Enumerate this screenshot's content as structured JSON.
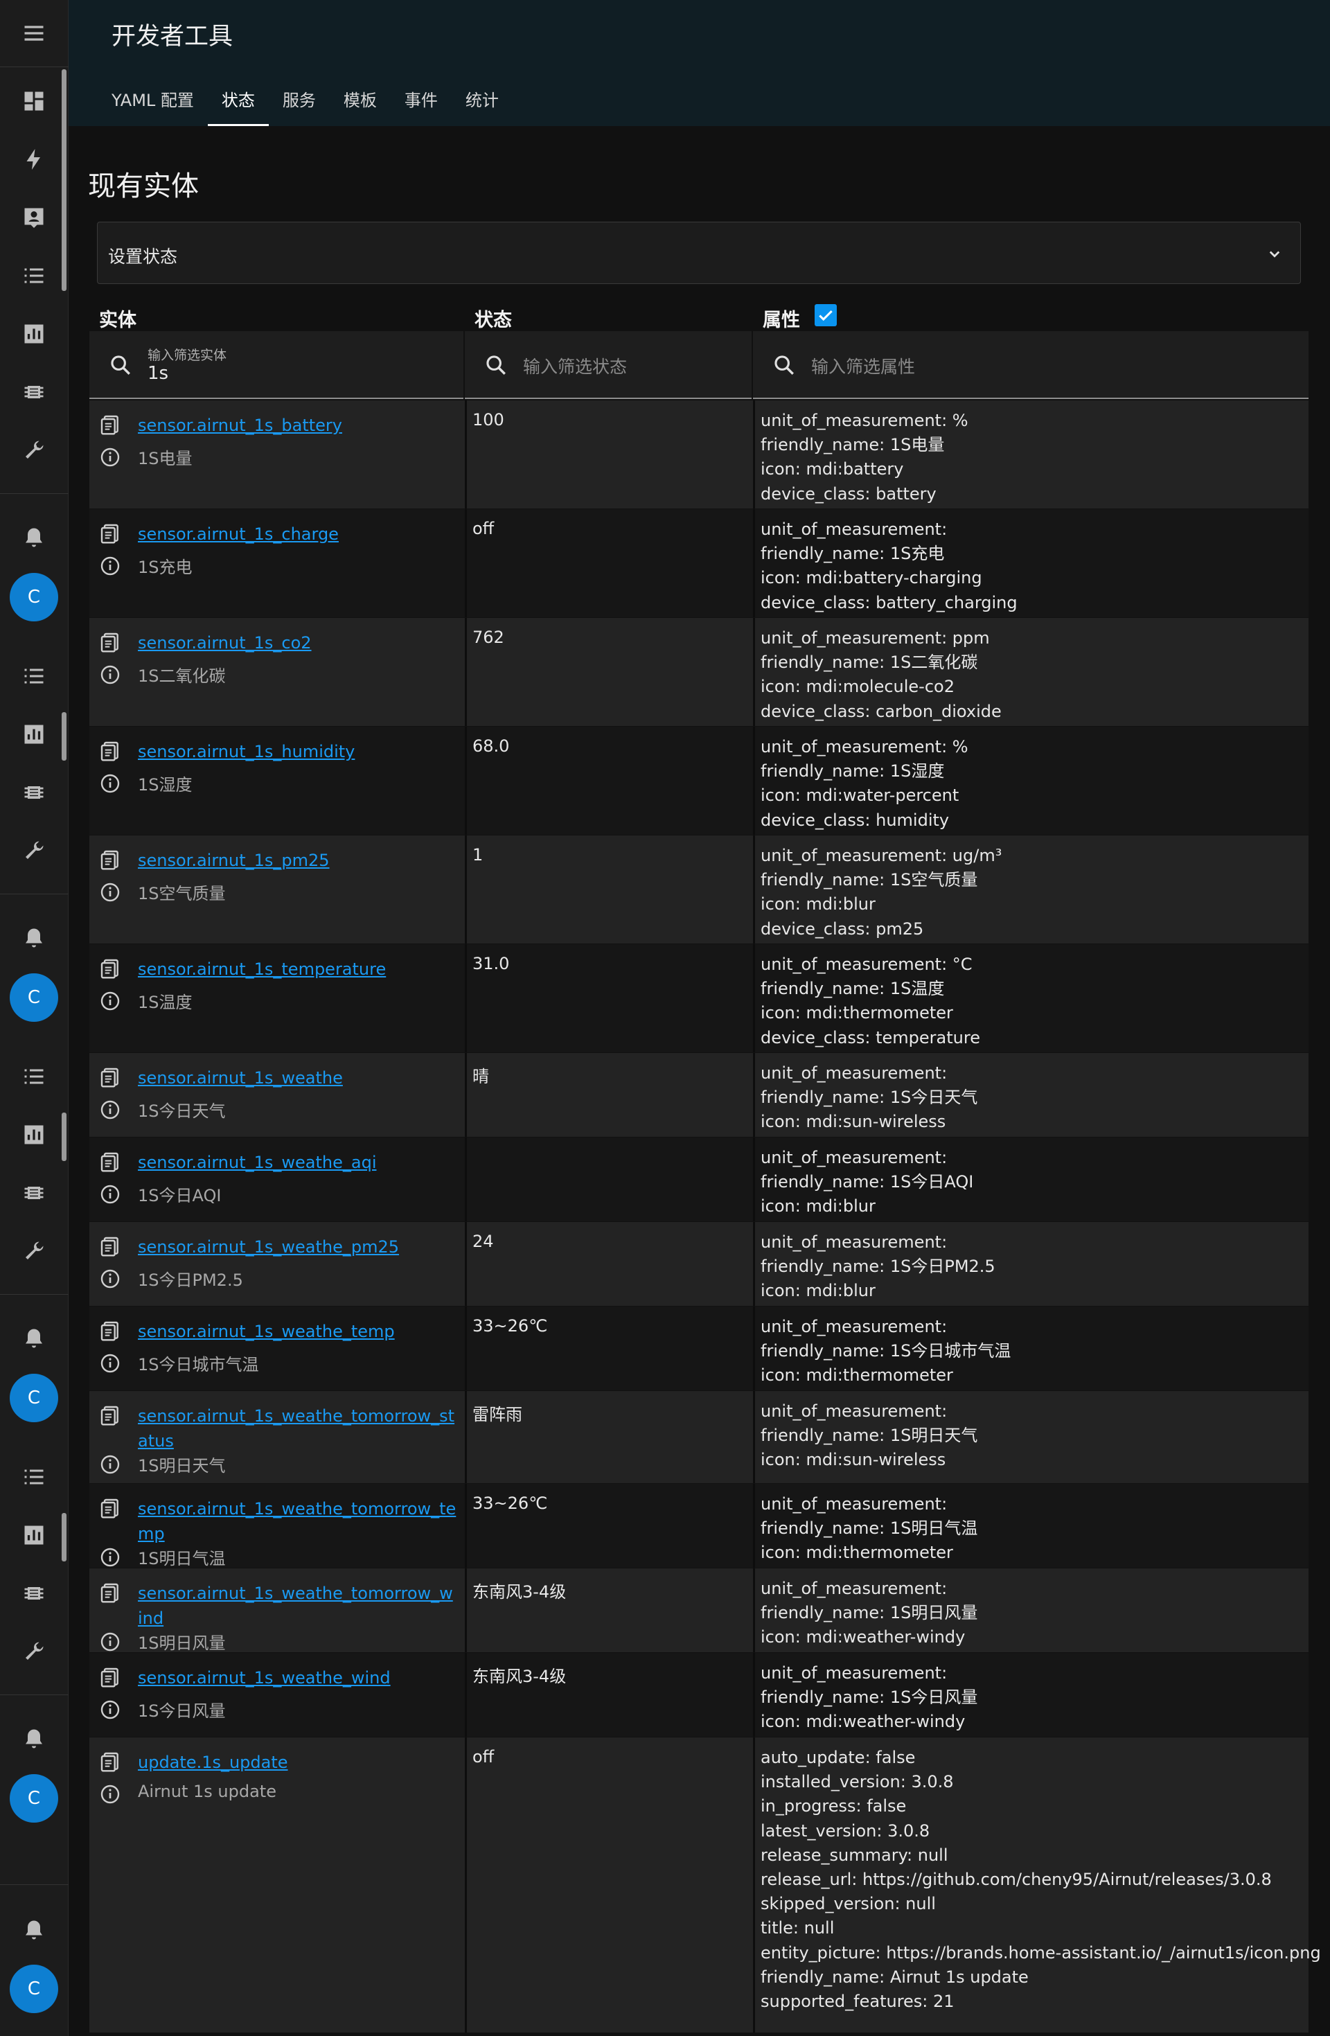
{
  "header": {
    "title": "开发者工具",
    "tabs": [
      {
        "label": "YAML 配置",
        "active": false
      },
      {
        "label": "状态",
        "active": true
      },
      {
        "label": "服务",
        "active": false
      },
      {
        "label": "模板",
        "active": false
      },
      {
        "label": "事件",
        "active": false
      },
      {
        "label": "统计",
        "active": false
      }
    ]
  },
  "sidebar": {
    "avatar_letter": "C",
    "icons": [
      "menu-icon",
      "dashboard-icon",
      "lightning-icon",
      "account-box-icon",
      "list-icon",
      "chart-icon",
      "chip-icon",
      "wrench-icon",
      "bell-icon"
    ]
  },
  "main": {
    "page_title": "现有实体",
    "set_state_label": "设置状态",
    "columns": {
      "entity": "实体",
      "state": "状态",
      "attributes": "属性"
    },
    "attributes_checked": true,
    "filters": {
      "entity_label": "输入筛选实体",
      "entity_value": "1s",
      "state_placeholder": "输入筛选状态",
      "attr_placeholder": "输入筛选属性"
    }
  },
  "accent_color": "#1a9af2",
  "rows": [
    {
      "entity_id": "sensor.airnut_1s_battery",
      "name": "1S电量",
      "state": "100",
      "attributes": [
        "unit_of_measurement: %",
        "friendly_name: 1S电量",
        "icon: mdi:battery",
        "device_class: battery"
      ]
    },
    {
      "entity_id": "sensor.airnut_1s_charge",
      "name": "1S充电",
      "state": "off",
      "attributes": [
        "unit_of_measurement: ",
        "friendly_name: 1S充电",
        "icon: mdi:battery-charging",
        "device_class: battery_charging"
      ]
    },
    {
      "entity_id": "sensor.airnut_1s_co2",
      "name": "1S二氧化碳",
      "state": "762",
      "attributes": [
        "unit_of_measurement: ppm",
        "friendly_name: 1S二氧化碳",
        "icon: mdi:molecule-co2",
        "device_class: carbon_dioxide"
      ]
    },
    {
      "entity_id": "sensor.airnut_1s_humidity",
      "name": "1S湿度",
      "state": "68.0",
      "attributes": [
        "unit_of_measurement: %",
        "friendly_name: 1S湿度",
        "icon: mdi:water-percent",
        "device_class: humidity"
      ]
    },
    {
      "entity_id": "sensor.airnut_1s_pm25",
      "name": "1S空气质量",
      "state": "1",
      "attributes": [
        "unit_of_measurement: ug/m³",
        "friendly_name: 1S空气质量",
        "icon: mdi:blur",
        "device_class: pm25"
      ]
    },
    {
      "entity_id": "sensor.airnut_1s_temperature",
      "name": "1S温度",
      "state": "31.0",
      "attributes": [
        "unit_of_measurement: °C",
        "friendly_name: 1S温度",
        "icon: mdi:thermometer",
        "device_class: temperature"
      ]
    },
    {
      "entity_id": "sensor.airnut_1s_weathe",
      "name": "1S今日天气",
      "state": "晴",
      "attributes": [
        "unit_of_measurement: ",
        "friendly_name: 1S今日天气",
        "icon: mdi:sun-wireless"
      ]
    },
    {
      "entity_id": "sensor.airnut_1s_weathe_aqi",
      "name": "1S今日AQI",
      "state": "",
      "attributes": [
        "unit_of_measurement: ",
        "friendly_name: 1S今日AQI",
        "icon: mdi:blur"
      ]
    },
    {
      "entity_id": "sensor.airnut_1s_weathe_pm25",
      "name": "1S今日PM2.5",
      "state": "24",
      "attributes": [
        "unit_of_measurement: ",
        "friendly_name: 1S今日PM2.5",
        "icon: mdi:blur"
      ]
    },
    {
      "entity_id": "sensor.airnut_1s_weathe_temp",
      "name": "1S今日城市气温",
      "state": "33~26℃",
      "attributes": [
        "unit_of_measurement: ",
        "friendly_name: 1S今日城市气温",
        "icon: mdi:thermometer"
      ]
    },
    {
      "entity_id": "sensor.airnut_1s_weathe_tomorrow_status",
      "name": "1S明日天气",
      "state": "雷阵雨",
      "attributes": [
        "unit_of_measurement: ",
        "friendly_name: 1S明日天气",
        "icon: mdi:sun-wireless"
      ]
    },
    {
      "entity_id": "sensor.airnut_1s_weathe_tomorrow_temp",
      "name": "1S明日气温",
      "state": "33~26℃",
      "attributes": [
        "unit_of_measurement: ",
        "friendly_name: 1S明日气温",
        "icon: mdi:thermometer"
      ]
    },
    {
      "entity_id": "sensor.airnut_1s_weathe_tomorrow_wind",
      "name": "1S明日风量",
      "state": "东南风3-4级",
      "attributes": [
        "unit_of_measurement: ",
        "friendly_name: 1S明日风量",
        "icon: mdi:weather-windy"
      ]
    },
    {
      "entity_id": "sensor.airnut_1s_weathe_wind",
      "name": "1S今日风量",
      "state": "东南风3-4级",
      "attributes": [
        "unit_of_measurement: ",
        "friendly_name: 1S今日风量",
        "icon: mdi:weather-windy"
      ]
    },
    {
      "entity_id": "update.1s_update",
      "name": "Airnut 1s update",
      "state": "off",
      "attributes": [
        "auto_update: false",
        "installed_version: 3.0.8",
        "in_progress: false",
        "latest_version: 3.0.8",
        "release_summary: null",
        "release_url: https://github.com/cheny95/Airnut/releases/3.0.8",
        "skipped_version: null",
        "title: null",
        "entity_picture: https://brands.home-assistant.io/_/airnut1s/icon.png",
        "friendly_name: Airnut 1s update",
        "supported_features: 21"
      ]
    }
  ]
}
